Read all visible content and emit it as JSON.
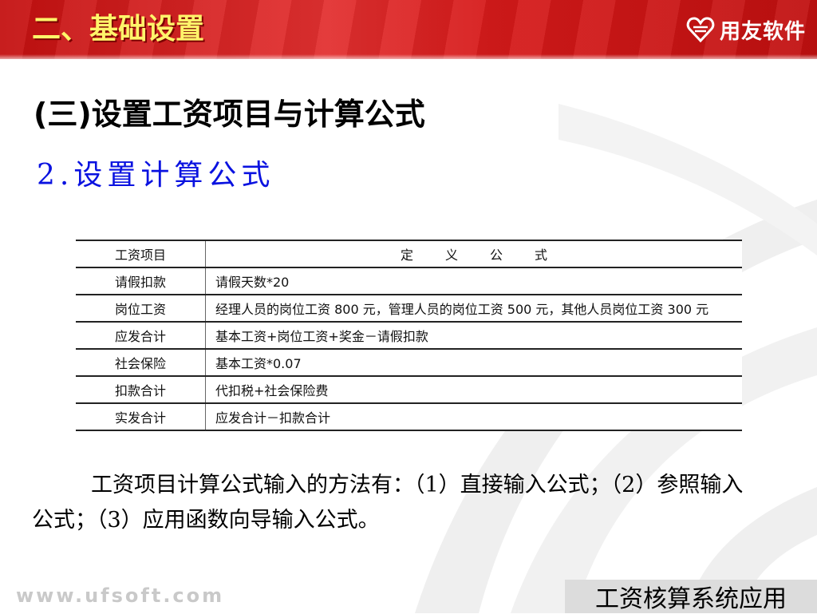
{
  "header": {
    "section_title": "二、基础设置",
    "brand_name": "用友软件",
    "brand_icon": "ufida-heart-icon"
  },
  "subtitle": "(三)设置工资项目与计算公式",
  "subsection": "2.设置计算公式",
  "table": {
    "columns": [
      "工资项目",
      "定义公式"
    ],
    "rows": [
      {
        "item": "请假扣款",
        "formula": "请假天数*20"
      },
      {
        "item": "岗位工资",
        "formula": "经理人员的岗位工资 800 元，管理人员的岗位工资 500 元，其他人员岗位工资 300 元"
      },
      {
        "item": "应发合计",
        "formula": "基本工资+岗位工资+奖金－请假扣款"
      },
      {
        "item": "社会保险",
        "formula": "基本工资*0.07"
      },
      {
        "item": "扣款合计",
        "formula": "代扣税+社会保险费"
      },
      {
        "item": "实发合计",
        "formula": "应发合计－扣款合计"
      }
    ]
  },
  "body_text": "工资项目计算公式输入的方法有：（1）直接输入公式；（2）参照输入公式；（3）应用函数向导输入公式。",
  "footer": {
    "url": "www.ufsoft.com",
    "course_title": "工资核算系统应用"
  },
  "colors": {
    "header_red": "#d61a1a",
    "title_yellow": "#fff46a",
    "subsection_blue": "#0a12e0",
    "footer_gray": "#dcdcdc"
  }
}
